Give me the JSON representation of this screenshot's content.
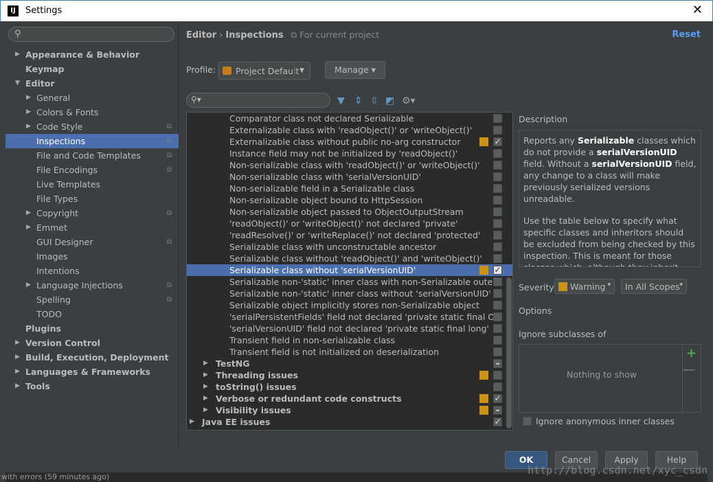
{
  "window": {
    "title": "Settings",
    "close_glyph": "✕",
    "app_icon_letter": "IJ"
  },
  "sidebar": {
    "items": [
      {
        "label": "Appearance & Behavior",
        "level": 0,
        "bold": true,
        "arrow": "▶"
      },
      {
        "label": "Keymap",
        "level": 0,
        "bold": true
      },
      {
        "label": "Editor",
        "level": 0,
        "bold": true,
        "arrow": "▼"
      },
      {
        "label": "General",
        "level": 1,
        "arrow": "▶"
      },
      {
        "label": "Colors & Fonts",
        "level": 1,
        "arrow": "▶"
      },
      {
        "label": "Code Style",
        "level": 1,
        "arrow": "▶",
        "project": true
      },
      {
        "label": "Inspections",
        "level": 1,
        "selected": true,
        "project": true
      },
      {
        "label": "File and Code Templates",
        "level": 1,
        "project": true
      },
      {
        "label": "File Encodings",
        "level": 1,
        "project": true
      },
      {
        "label": "Live Templates",
        "level": 1
      },
      {
        "label": "File Types",
        "level": 1
      },
      {
        "label": "Copyright",
        "level": 1,
        "arrow": "▶",
        "project": true
      },
      {
        "label": "Emmet",
        "level": 1,
        "arrow": "▶"
      },
      {
        "label": "GUI Designer",
        "level": 1,
        "project": true
      },
      {
        "label": "Images",
        "level": 1
      },
      {
        "label": "Intentions",
        "level": 1
      },
      {
        "label": "Language Injections",
        "level": 1,
        "arrow": "▶",
        "project": true
      },
      {
        "label": "Spelling",
        "level": 1,
        "project": true
      },
      {
        "label": "TODO",
        "level": 1
      },
      {
        "label": "Plugins",
        "level": 0,
        "bold": true
      },
      {
        "label": "Version Control",
        "level": 0,
        "bold": true,
        "arrow": "▶"
      },
      {
        "label": "Build, Execution, Deployment",
        "level": 0,
        "bold": true,
        "arrow": "▶"
      },
      {
        "label": "Languages & Frameworks",
        "level": 0,
        "bold": true,
        "arrow": "▶"
      },
      {
        "label": "Tools",
        "level": 0,
        "bold": true,
        "arrow": "▶"
      }
    ]
  },
  "header": {
    "crumb_editor": "Editor",
    "crumb_sep": "›",
    "crumb_inspections": "Inspections",
    "scope_note": "For current project",
    "reset_label": "Reset"
  },
  "profile": {
    "label": "Profile:",
    "value": "Project Default",
    "manage_label": "Manage ▾"
  },
  "inspections": [
    {
      "label": "Comparator class not declared Serializable",
      "level": 2,
      "severity": false,
      "checked": false
    },
    {
      "label": "Externalizable class with 'readObject()' or 'writeObject()'",
      "level": 2,
      "severity": false,
      "checked": false
    },
    {
      "label": "Externalizable class without public no-arg constructor",
      "level": 2,
      "severity": true,
      "checked": true
    },
    {
      "label": "Instance field may not be initialized by 'readObject()'",
      "level": 2,
      "severity": false,
      "checked": false
    },
    {
      "label": "Non-serializable class with 'readObject()' or 'writeObject()'",
      "level": 2,
      "severity": false,
      "checked": false
    },
    {
      "label": "Non-serializable class with 'serialVersionUID'",
      "level": 2,
      "severity": false,
      "checked": false
    },
    {
      "label": "Non-serializable field in a Serializable class",
      "level": 2,
      "severity": false,
      "checked": false
    },
    {
      "label": "Non-serializable object bound to HttpSession",
      "level": 2,
      "severity": false,
      "checked": false
    },
    {
      "label": "Non-serializable object passed to ObjectOutputStream",
      "level": 2,
      "severity": false,
      "checked": false
    },
    {
      "label": "'readObject()' or 'writeObject()' not declared 'private'",
      "level": 2,
      "severity": false,
      "checked": false
    },
    {
      "label": "'readResolve()' or 'writeReplace()' not declared 'protected'",
      "level": 2,
      "severity": false,
      "checked": false
    },
    {
      "label": "Serializable class with unconstructable ancestor",
      "level": 2,
      "severity": false,
      "checked": false
    },
    {
      "label": "Serializable class without 'readObject()' and 'writeObject()'",
      "level": 2,
      "severity": false,
      "checked": false
    },
    {
      "label": "Serializable class without 'serialVersionUID'",
      "level": 2,
      "severity": true,
      "checked": true,
      "selected": true
    },
    {
      "label": "Serializable non-'static' inner class with non-Serializable outer",
      "level": 2,
      "severity": false,
      "checked": false
    },
    {
      "label": "Serializable non-'static' inner class without 'serialVersionUID'",
      "level": 2,
      "severity": false,
      "checked": false
    },
    {
      "label": "Serializable object implicitly stores non-Serializable object",
      "level": 2,
      "severity": false,
      "checked": false
    },
    {
      "label": "'serialPersistentFields' field not declared 'private static final Ol",
      "level": 2,
      "severity": false,
      "checked": false
    },
    {
      "label": "'serialVersionUID' field not declared 'private static final long'",
      "level": 2,
      "severity": false,
      "checked": false
    },
    {
      "label": "Transient field in non-serializable class",
      "level": 2,
      "severity": false,
      "checked": false
    },
    {
      "label": "Transient field is not initialized on deserialization",
      "level": 2,
      "severity": false,
      "checked": false
    },
    {
      "label": "TestNG",
      "level": 1,
      "bold": true,
      "arrow": "▶",
      "severity": false,
      "checked": "mixed"
    },
    {
      "label": "Threading issues",
      "level": 1,
      "bold": true,
      "arrow": "▶",
      "severity": true,
      "checked": false
    },
    {
      "label": "toString() issues",
      "level": 1,
      "bold": true,
      "arrow": "▶",
      "severity": false,
      "checked": false
    },
    {
      "label": "Verbose or redundant code constructs",
      "level": 1,
      "bold": true,
      "arrow": "▶",
      "severity": true,
      "checked": true
    },
    {
      "label": "Visibility issues",
      "level": 1,
      "bold": true,
      "arrow": "▶",
      "severity": true,
      "checked": "mixed"
    },
    {
      "label": "Java EE issues",
      "level": 0,
      "bold": true,
      "arrow": "▶",
      "severity": false,
      "checked": true
    }
  ],
  "description": {
    "label": "Description",
    "p1_a": "Reports any ",
    "p1_b": "Serializable",
    "p1_c": " classes which do not provide a ",
    "p1_d": "serialVersionUID",
    "p1_e": " field. Without a ",
    "p1_f": "serialVersionUID",
    "p1_g": " field, any change to a class will make previously serialized versions unreadable.",
    "p2": "Use the table below to specify what specific classes and inheritors should be excluded from being checked by this inspection. This is meant for those classes which, although they inherit"
  },
  "severity": {
    "label": "Severity:",
    "value": "Warning",
    "scope": "In All Scopes",
    "caret": "▾"
  },
  "options": {
    "label": "Options",
    "ignore_label": "Ignore subclasses of",
    "empty_text": "Nothing to show",
    "add_glyph": "+",
    "remove_glyph": "—",
    "anon_label": "Ignore anonymous inner classes"
  },
  "buttons": {
    "ok": "OK",
    "cancel": "Cancel",
    "apply": "Apply",
    "help": "Help"
  },
  "watermark": "http://blog.csdn.net/xyc_csdn",
  "background_status": "with errors (59 minutes ago)",
  "colors": {
    "accent": "#4b6eaf",
    "warning": "#c8921c",
    "link": "#589df6",
    "panel": "#3c3f41"
  }
}
